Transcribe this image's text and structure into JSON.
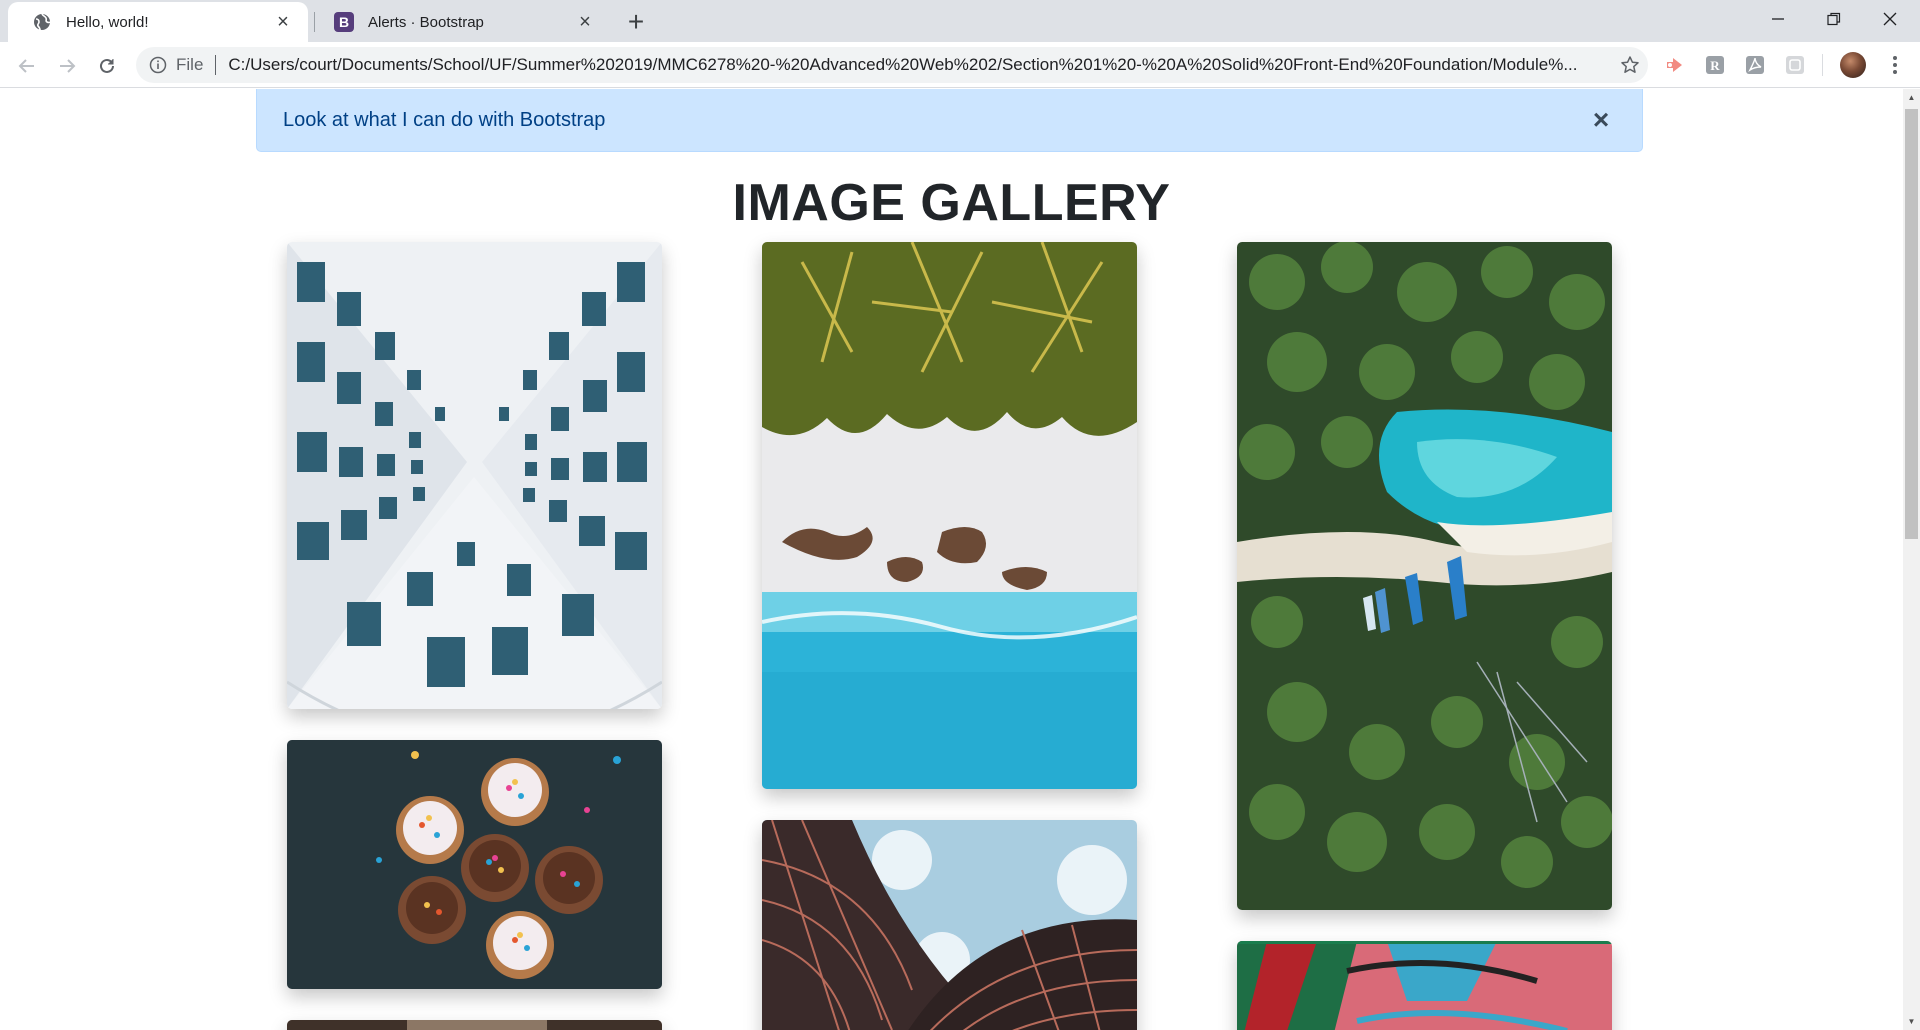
{
  "browser": {
    "tabs": [
      {
        "title": "Hello, world!",
        "active": true,
        "icon": "globe-icon"
      },
      {
        "title": "Alerts · Bootstrap",
        "active": false,
        "icon": "bootstrap-icon"
      }
    ],
    "new_tab_icon": "plus-icon",
    "window_controls": [
      "minimize-icon",
      "restore-icon",
      "close-icon"
    ],
    "address": {
      "scheme_label": "File",
      "url": "C:/Users/court/Documents/School/UF/Summer%202019/MMC6278%20-%20Advanced%20Web%202/Section%201%20-%20A%20Solid%20Front-End%20Foundation/Module%..."
    }
  },
  "page": {
    "alert": {
      "text": "Look at what I can do with Bootstrap",
      "close_label": "×",
      "background": "#cce5ff",
      "text_color": "#004085"
    },
    "heading": "IMAGE GALLERY",
    "gallery": [
      {
        "id": "building-windows",
        "subject": "white building windows"
      },
      {
        "id": "cupcakes",
        "subject": "cupcakes with sprinkles"
      },
      {
        "id": "palm-beach",
        "subject": "palm trees over beach and sea"
      },
      {
        "id": "curved-tower",
        "subject": "curved glass tower"
      },
      {
        "id": "palm-boats",
        "subject": "palm forest with boats"
      },
      {
        "id": "graffiti",
        "subject": "graffiti wall"
      }
    ]
  }
}
